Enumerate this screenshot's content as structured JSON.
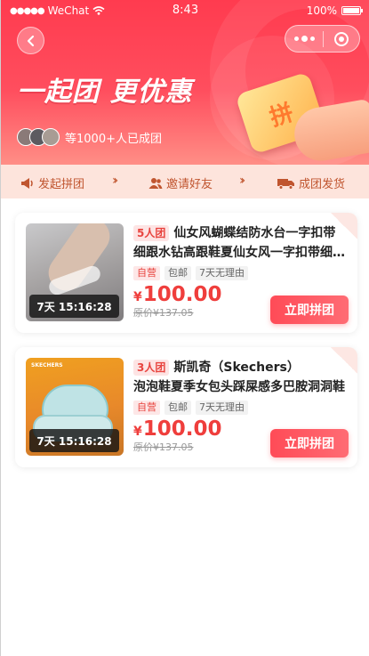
{
  "status_bar": {
    "carrier": "WeChat",
    "time": "8:43",
    "battery": "100%"
  },
  "hero": {
    "title": "一起团 更优惠",
    "joined_text": "等1000+人已成团",
    "ticket_char": "拼"
  },
  "steps": [
    {
      "label": "发起拼团",
      "icon": "megaphone-icon"
    },
    {
      "label": "邀请好友",
      "icon": "users-icon"
    },
    {
      "label": "成团发货",
      "icon": "truck-icon"
    }
  ],
  "products": [
    {
      "group_size": "5人团",
      "title_line1": "仙女风蝴蝶结防水台一字扣带",
      "title_line2": "细跟水钻高跟鞋夏仙女风一字扣带细跟水钻高跟鞋",
      "tags": [
        "自营",
        "包邮",
        "7天无理由"
      ],
      "currency": "¥",
      "price": "100.00",
      "original_price": "原价¥137.05",
      "countdown": "7天 15:16:28",
      "button": "立即拼团"
    },
    {
      "group_size": "3人团",
      "title_line1": "斯凯奇（Skechers）",
      "title_line2": "泡泡鞋夏季女包头踩屎感多巴胺洞洞鞋",
      "brand_mark": "SKECHERS",
      "tags": [
        "自营",
        "包邮",
        "7天无理由"
      ],
      "currency": "¥",
      "price": "100.00",
      "original_price": "原价¥137.05",
      "countdown": "7天 15:16:28",
      "button": "立即拼团"
    }
  ],
  "colors": {
    "brand_red": "#ff3b4f",
    "price_red": "#ef3e3c",
    "steps_bg": "#fde4dc",
    "steps_text": "#c0552f"
  }
}
